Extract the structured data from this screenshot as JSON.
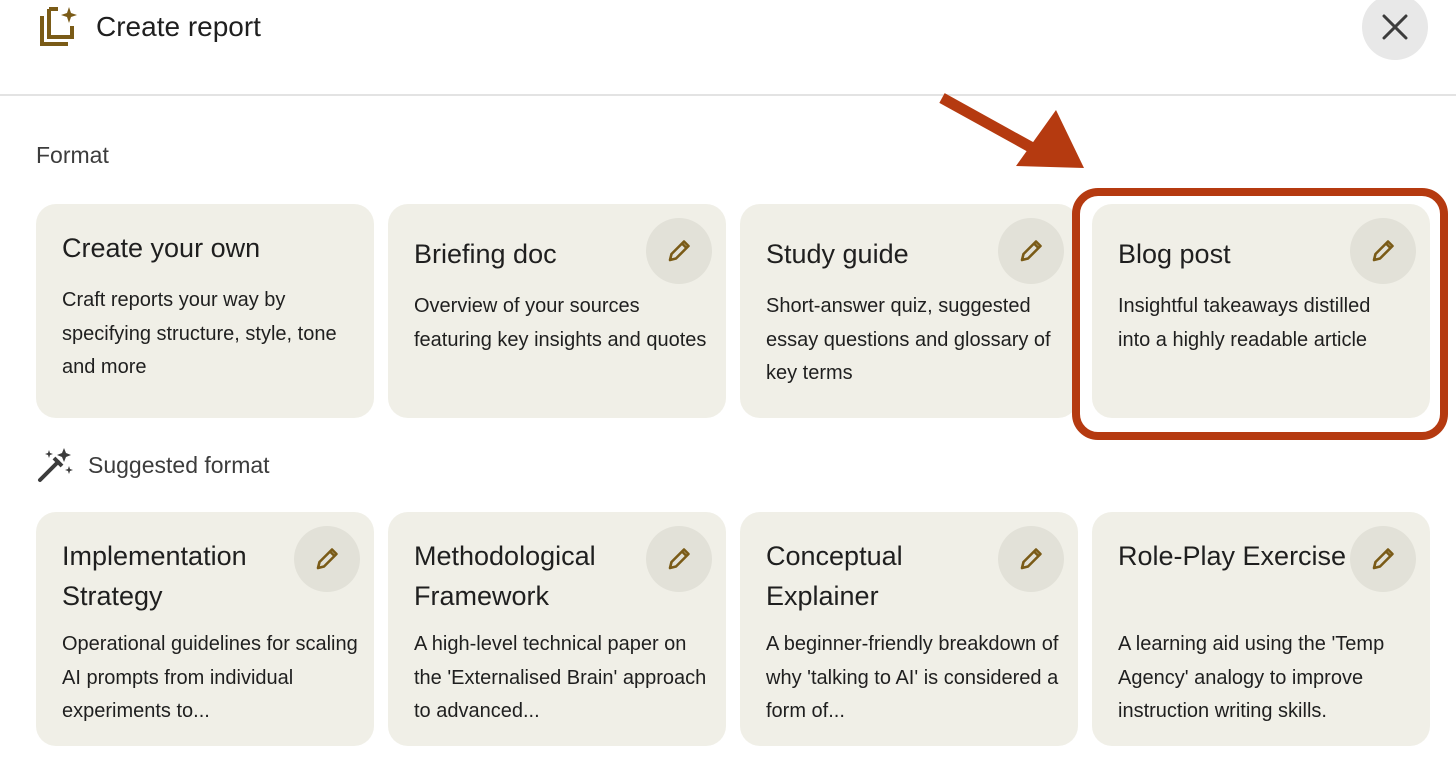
{
  "header": {
    "title": "Create report",
    "icon": "report-sparkle-icon",
    "close_icon": "close-icon"
  },
  "format_section": {
    "label": "Format",
    "cards": [
      {
        "title": "Create your own",
        "description": "Craft reports your way by specifying structure, style, tone and more"
      },
      {
        "title": "Briefing doc",
        "description": "Overview of your sources featuring key insights and quotes"
      },
      {
        "title": "Study guide",
        "description": "Short-answer quiz, suggested essay questions and glossary of key terms"
      },
      {
        "title": "Blog post",
        "description": "Insightful takeaways distilled into a highly readable article"
      }
    ]
  },
  "suggested_section": {
    "label": "Suggested format",
    "icon": "magic-wand-icon",
    "cards": [
      {
        "title": "Implementation Strategy",
        "description": "Operational guidelines for scaling AI prompts from individual experiments to..."
      },
      {
        "title": "Methodological Framework",
        "description": "A high-level technical paper on the 'Externalised Brain' approach to advanced..."
      },
      {
        "title": "Conceptual Explainer",
        "description": "A beginner-friendly breakdown of why 'talking to AI' is considered a form of..."
      },
      {
        "title": "Role-Play Exercise",
        "description": "A learning aid using the 'Temp Agency' analogy to improve instruction writing skills."
      }
    ]
  },
  "colors": {
    "card_bg": "#f0efe7",
    "accent_icon": "#7a5b17",
    "annotation": "#b53a10"
  }
}
